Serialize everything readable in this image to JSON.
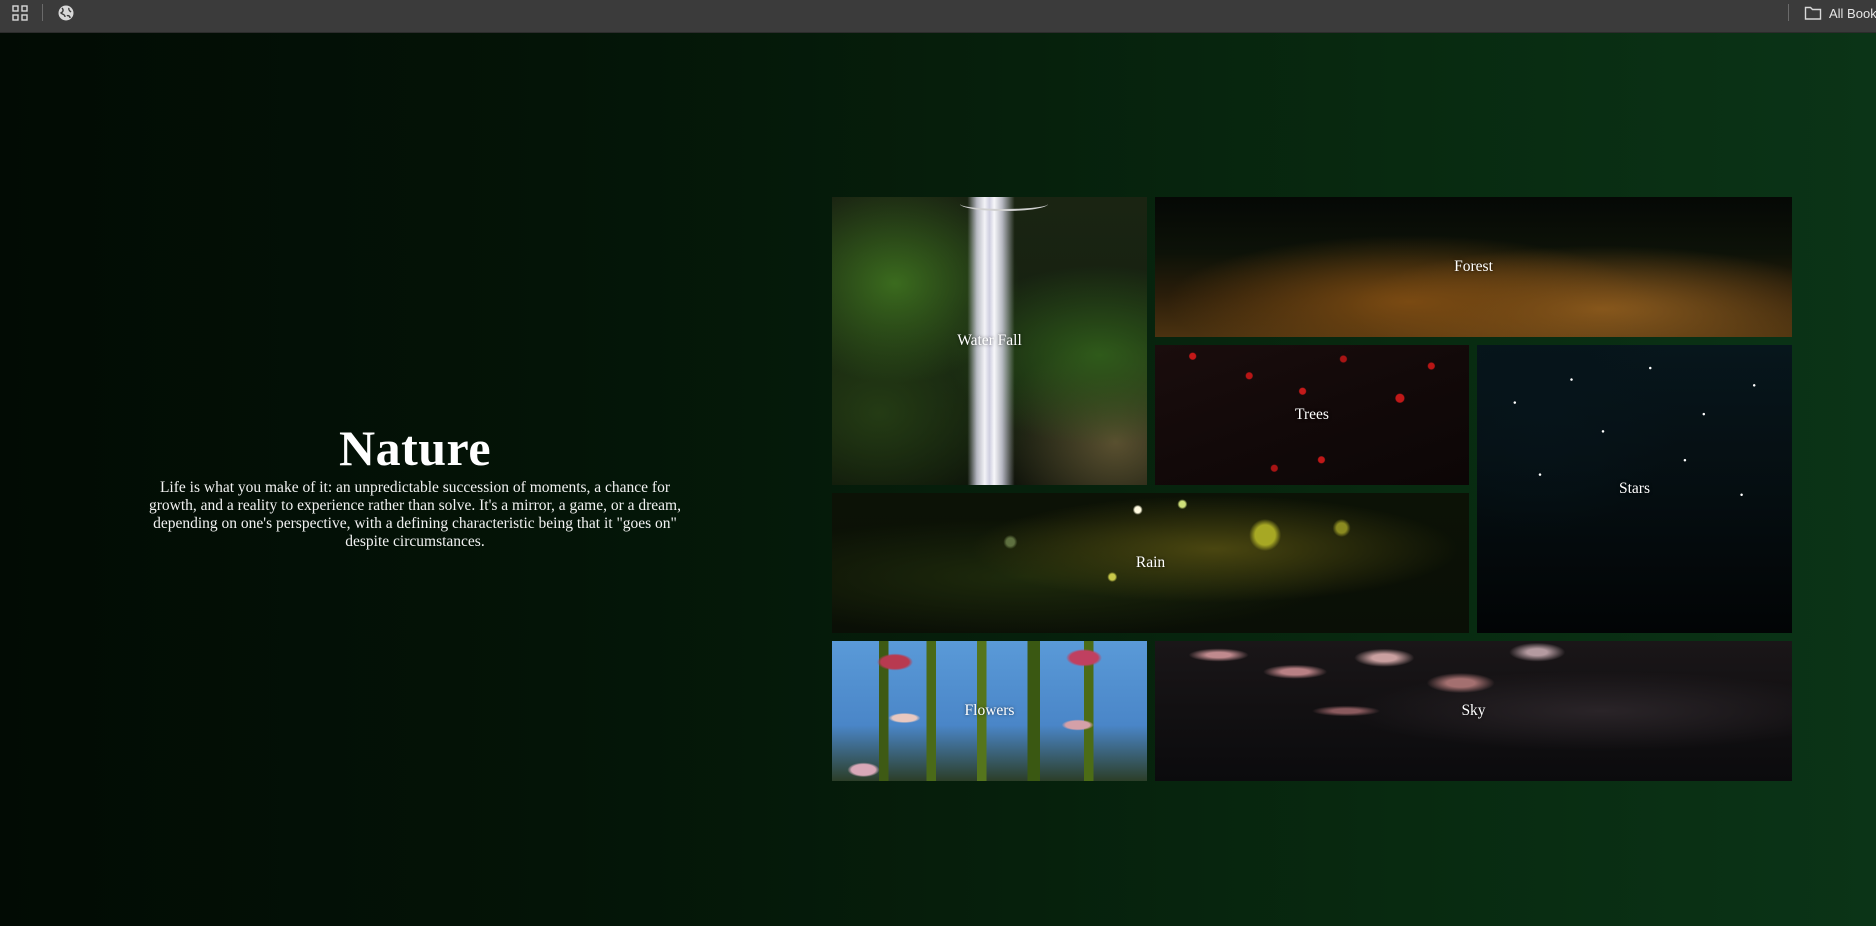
{
  "browser": {
    "apps_icon": "apps-grid-icon",
    "globe_icon": "globe-icon",
    "all_bookmarks_label": "All Bookmarks",
    "folder_icon": "folder-icon"
  },
  "hero": {
    "title": "Nature",
    "description": "Life is what you make of it: an unpredictable succession of moments, a chance for growth, and a reality to experience rather than solve. It's a mirror, a game, or a dream, depending on one's perspective, with a defining characteristic being that it \"goes on\" despite circumstances."
  },
  "gallery": {
    "tiles": [
      {
        "label": "Water Fall"
      },
      {
        "label": "Forest"
      },
      {
        "label": "Trees"
      },
      {
        "label": "Stars"
      },
      {
        "label": "Rain"
      },
      {
        "label": "Flowers"
      },
      {
        "label": "Sky"
      }
    ]
  },
  "colors": {
    "page_bg_dark": "#020b04",
    "page_bg_green": "#0b3417",
    "grid_gap": "#0c3317",
    "text": "#ffffff"
  }
}
